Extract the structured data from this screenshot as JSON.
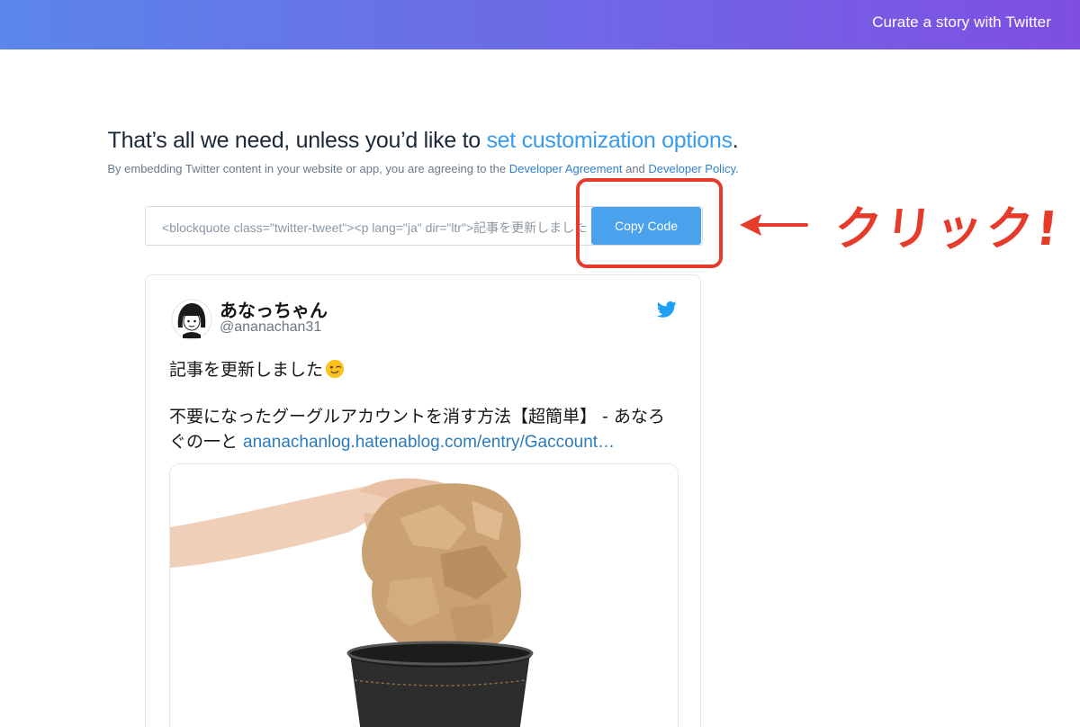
{
  "header": {
    "link_label": "Curate a story with Twitter"
  },
  "intro": {
    "headline_prefix": "That’s all we need, unless you’d like to ",
    "headline_link": "set customization options",
    "headline_suffix": ".",
    "sub_prefix": "By embedding Twitter content in your website or app, you are agreeing to the ",
    "sub_link1": "Developer Agreement",
    "sub_middle": " and ",
    "sub_link2": "Developer Policy",
    "sub_suffix": "."
  },
  "embed": {
    "code": "<blockquote class=\"twitter-tweet\"><p lang=\"ja\" dir=\"ltr\">記事を更新しました",
    "copy_button": "Copy Code"
  },
  "annotation": {
    "text": "クリック!",
    "color": "#e63a2a"
  },
  "tweet": {
    "display_name": "あなっちゃん",
    "handle": "@ananachan31",
    "line1": "記事を更新しました",
    "emoji": "winking-face-icon",
    "line2_text": "不要になったグーグルアカウントを消す方法【超簡単】 - あなろぐの一と ",
    "line2_link": "ananachanlog.hatenablog.com/entry/Gaccount…"
  },
  "colors": {
    "accent": "#4aa1ec",
    "link": "#3a9be9",
    "header_gradient_start": "#5b86ea",
    "header_gradient_end": "#7f4fe2"
  }
}
